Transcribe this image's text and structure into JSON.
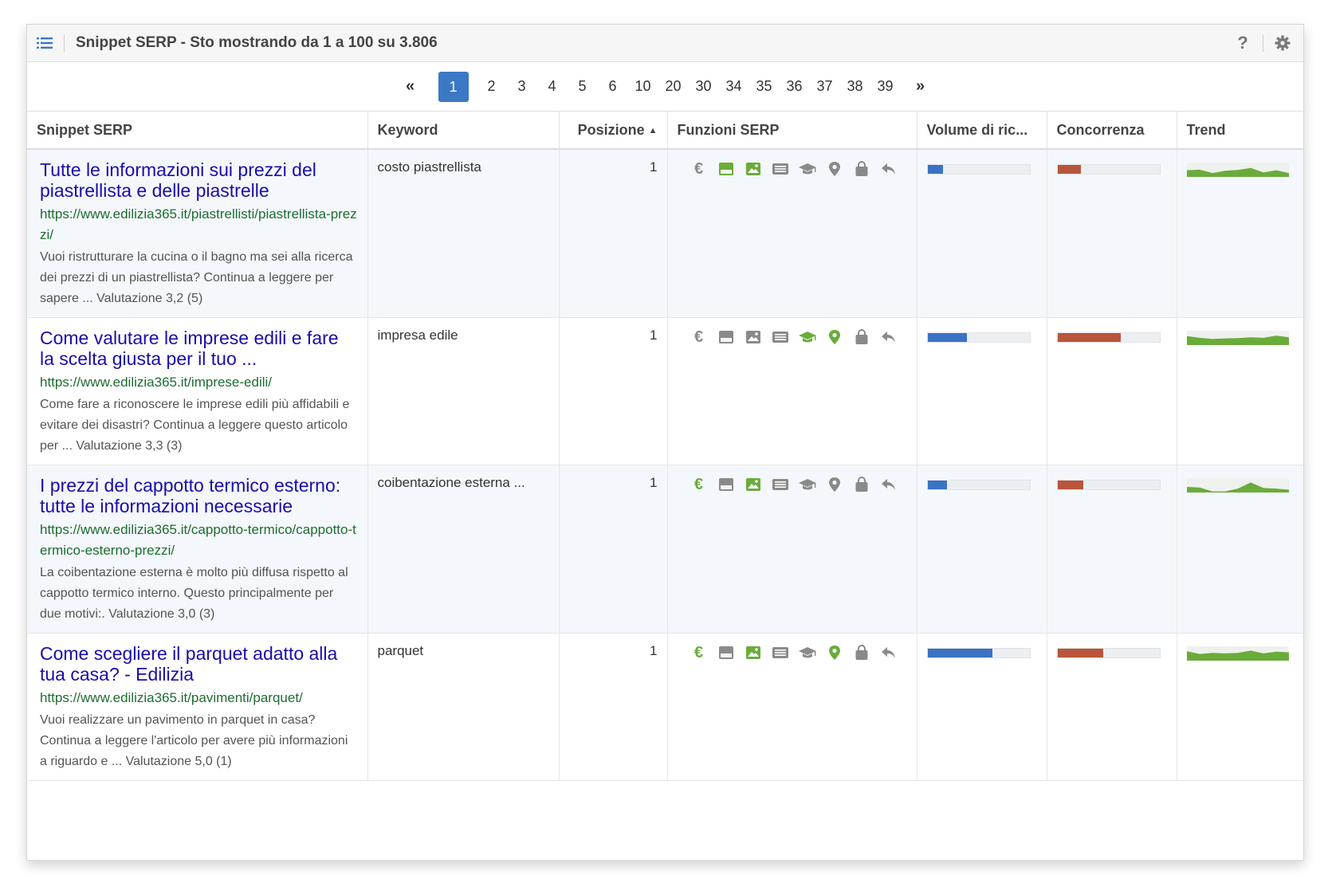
{
  "header": {
    "title": "Snippet SERP - Sto mostrando da 1 a 100 su 3.806",
    "help_label": "?"
  },
  "pagination": {
    "first_label": "«",
    "last_label": "»",
    "pages": [
      "1",
      "2",
      "3",
      "4",
      "5",
      "6",
      "10",
      "20",
      "30",
      "34",
      "35",
      "36",
      "37",
      "38",
      "39"
    ],
    "current": "1"
  },
  "columns": {
    "snippet": "Snippet SERP",
    "keyword": "Keyword",
    "position": "Posizione",
    "serp_features": "Funzioni SERP",
    "volume": "Volume di ric...",
    "competition": "Concorrenza",
    "trend": "Trend"
  },
  "feature_icons": [
    "euro-icon",
    "featured-snippet-icon",
    "image-icon",
    "news-icon",
    "graduation-cap-icon",
    "map-pin-icon",
    "shopping-bag-icon",
    "reply-icon"
  ],
  "colors": {
    "active_page": "#3b78c6",
    "feature_active": "#6aac3a",
    "feature_inactive": "#8a8a8a",
    "volume_bar": "#3b72c4",
    "competition_bar": "#b8553a",
    "trend": "#6aac3a",
    "link_title": "#1a0dab",
    "link_url": "#1d6c30"
  },
  "rows": [
    {
      "title": "Tutte le informazioni sui prezzi del piastrellista e delle piastrelle",
      "url": "https://www.edilizia365.it/piastrellisti/piastrellista-prezzi/",
      "description": "Vuoi ristrutturare la cucina o il bagno ma sei alla ricerca dei prezzi di un piastrellista? Continua a leggere per sapere ... Valutazione 3,2 (5)",
      "keyword": "costo piastrellista",
      "position": "1",
      "features_active": [
        false,
        true,
        true,
        false,
        false,
        false,
        false,
        false
      ],
      "volume_fraction": 0.15,
      "competition_fraction": 0.23,
      "trend": [
        0.6,
        0.65,
        0.35,
        0.55,
        0.62,
        0.8,
        0.4,
        0.6,
        0.35
      ]
    },
    {
      "title": "Come valutare le imprese edili e fare la scelta giusta per il tuo ...",
      "url": "https://www.edilizia365.it/imprese-edili/",
      "description": "Come fare a riconoscere le imprese edili più affidabili e evitare dei disastri? Continua a leggere questo articolo per ... Valutazione 3,3 (3)",
      "keyword": "impresa edile",
      "position": "1",
      "features_active": [
        false,
        false,
        false,
        false,
        true,
        true,
        false,
        false
      ],
      "volume_fraction": 0.39,
      "competition_fraction": 0.62,
      "trend": [
        0.8,
        0.65,
        0.55,
        0.6,
        0.62,
        0.7,
        0.65,
        0.85,
        0.7
      ]
    },
    {
      "title": "I prezzi del cappotto termico esterno: tutte le informazioni necessarie",
      "url": "https://www.edilizia365.it/cappotto-termico/cappotto-termico-esterno-prezzi/",
      "description": "La coibentazione esterna è molto più diffusa rispetto al cappotto termico interno. Questo principalmente per due motivi:. Valutazione 3,0 (3)",
      "keyword": "coibentazione esterna ...",
      "position": "1",
      "features_active": [
        true,
        false,
        true,
        false,
        false,
        false,
        false,
        false
      ],
      "volume_fraction": 0.19,
      "competition_fraction": 0.25,
      "trend": [
        0.5,
        0.45,
        0.1,
        0.1,
        0.35,
        0.9,
        0.4,
        0.35,
        0.25
      ]
    },
    {
      "title": "Come scegliere il parquet adatto alla tua casa? - Edilizia",
      "url": "https://www.edilizia365.it/pavimenti/parquet/",
      "description": "Vuoi realizzare un pavimento in parquet in casa? Continua a leggere l'articolo per avere più informazioni a riguardo e ... Valutazione 5,0 (1)",
      "keyword": "parquet",
      "position": "1",
      "features_active": [
        true,
        false,
        true,
        false,
        false,
        true,
        false,
        false
      ],
      "volume_fraction": 0.64,
      "competition_fraction": 0.45,
      "trend": [
        0.85,
        0.6,
        0.7,
        0.65,
        0.7,
        0.9,
        0.65,
        0.8,
        0.75
      ]
    }
  ]
}
